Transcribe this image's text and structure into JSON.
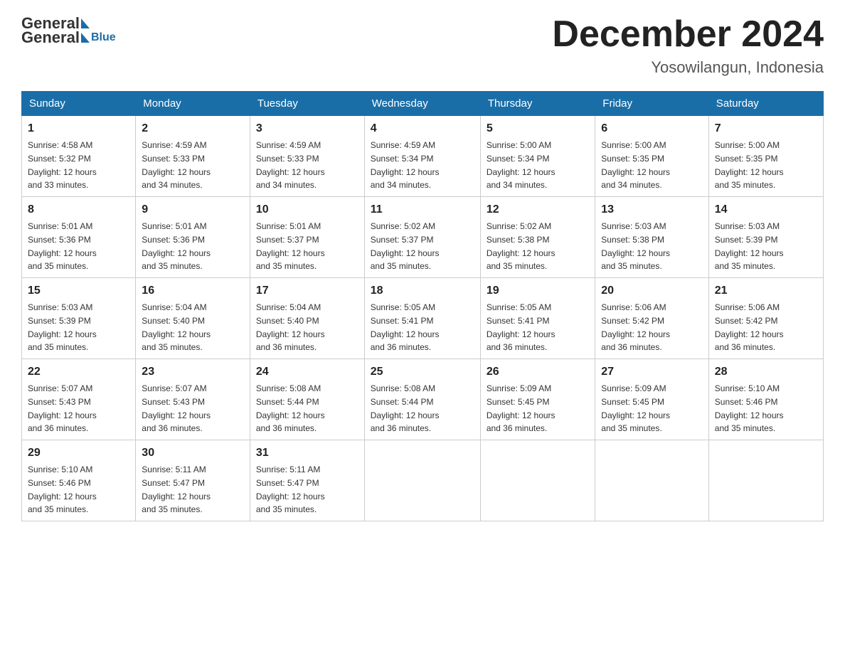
{
  "header": {
    "logo_general": "General",
    "logo_blue": "Blue",
    "month_title": "December 2024",
    "location": "Yosowilangun, Indonesia"
  },
  "days_of_week": [
    "Sunday",
    "Monday",
    "Tuesday",
    "Wednesday",
    "Thursday",
    "Friday",
    "Saturday"
  ],
  "weeks": [
    [
      {
        "day": "1",
        "sunrise": "4:58 AM",
        "sunset": "5:32 PM",
        "daylight": "12 hours and 33 minutes."
      },
      {
        "day": "2",
        "sunrise": "4:59 AM",
        "sunset": "5:33 PM",
        "daylight": "12 hours and 34 minutes."
      },
      {
        "day": "3",
        "sunrise": "4:59 AM",
        "sunset": "5:33 PM",
        "daylight": "12 hours and 34 minutes."
      },
      {
        "day": "4",
        "sunrise": "4:59 AM",
        "sunset": "5:34 PM",
        "daylight": "12 hours and 34 minutes."
      },
      {
        "day": "5",
        "sunrise": "5:00 AM",
        "sunset": "5:34 PM",
        "daylight": "12 hours and 34 minutes."
      },
      {
        "day": "6",
        "sunrise": "5:00 AM",
        "sunset": "5:35 PM",
        "daylight": "12 hours and 34 minutes."
      },
      {
        "day": "7",
        "sunrise": "5:00 AM",
        "sunset": "5:35 PM",
        "daylight": "12 hours and 35 minutes."
      }
    ],
    [
      {
        "day": "8",
        "sunrise": "5:01 AM",
        "sunset": "5:36 PM",
        "daylight": "12 hours and 35 minutes."
      },
      {
        "day": "9",
        "sunrise": "5:01 AM",
        "sunset": "5:36 PM",
        "daylight": "12 hours and 35 minutes."
      },
      {
        "day": "10",
        "sunrise": "5:01 AM",
        "sunset": "5:37 PM",
        "daylight": "12 hours and 35 minutes."
      },
      {
        "day": "11",
        "sunrise": "5:02 AM",
        "sunset": "5:37 PM",
        "daylight": "12 hours and 35 minutes."
      },
      {
        "day": "12",
        "sunrise": "5:02 AM",
        "sunset": "5:38 PM",
        "daylight": "12 hours and 35 minutes."
      },
      {
        "day": "13",
        "sunrise": "5:03 AM",
        "sunset": "5:38 PM",
        "daylight": "12 hours and 35 minutes."
      },
      {
        "day": "14",
        "sunrise": "5:03 AM",
        "sunset": "5:39 PM",
        "daylight": "12 hours and 35 minutes."
      }
    ],
    [
      {
        "day": "15",
        "sunrise": "5:03 AM",
        "sunset": "5:39 PM",
        "daylight": "12 hours and 35 minutes."
      },
      {
        "day": "16",
        "sunrise": "5:04 AM",
        "sunset": "5:40 PM",
        "daylight": "12 hours and 35 minutes."
      },
      {
        "day": "17",
        "sunrise": "5:04 AM",
        "sunset": "5:40 PM",
        "daylight": "12 hours and 36 minutes."
      },
      {
        "day": "18",
        "sunrise": "5:05 AM",
        "sunset": "5:41 PM",
        "daylight": "12 hours and 36 minutes."
      },
      {
        "day": "19",
        "sunrise": "5:05 AM",
        "sunset": "5:41 PM",
        "daylight": "12 hours and 36 minutes."
      },
      {
        "day": "20",
        "sunrise": "5:06 AM",
        "sunset": "5:42 PM",
        "daylight": "12 hours and 36 minutes."
      },
      {
        "day": "21",
        "sunrise": "5:06 AM",
        "sunset": "5:42 PM",
        "daylight": "12 hours and 36 minutes."
      }
    ],
    [
      {
        "day": "22",
        "sunrise": "5:07 AM",
        "sunset": "5:43 PM",
        "daylight": "12 hours and 36 minutes."
      },
      {
        "day": "23",
        "sunrise": "5:07 AM",
        "sunset": "5:43 PM",
        "daylight": "12 hours and 36 minutes."
      },
      {
        "day": "24",
        "sunrise": "5:08 AM",
        "sunset": "5:44 PM",
        "daylight": "12 hours and 36 minutes."
      },
      {
        "day": "25",
        "sunrise": "5:08 AM",
        "sunset": "5:44 PM",
        "daylight": "12 hours and 36 minutes."
      },
      {
        "day": "26",
        "sunrise": "5:09 AM",
        "sunset": "5:45 PM",
        "daylight": "12 hours and 36 minutes."
      },
      {
        "day": "27",
        "sunrise": "5:09 AM",
        "sunset": "5:45 PM",
        "daylight": "12 hours and 35 minutes."
      },
      {
        "day": "28",
        "sunrise": "5:10 AM",
        "sunset": "5:46 PM",
        "daylight": "12 hours and 35 minutes."
      }
    ],
    [
      {
        "day": "29",
        "sunrise": "5:10 AM",
        "sunset": "5:46 PM",
        "daylight": "12 hours and 35 minutes."
      },
      {
        "day": "30",
        "sunrise": "5:11 AM",
        "sunset": "5:47 PM",
        "daylight": "12 hours and 35 minutes."
      },
      {
        "day": "31",
        "sunrise": "5:11 AM",
        "sunset": "5:47 PM",
        "daylight": "12 hours and 35 minutes."
      },
      null,
      null,
      null,
      null
    ]
  ],
  "labels": {
    "sunrise": "Sunrise:",
    "sunset": "Sunset:",
    "daylight": "Daylight: 12 hours"
  }
}
